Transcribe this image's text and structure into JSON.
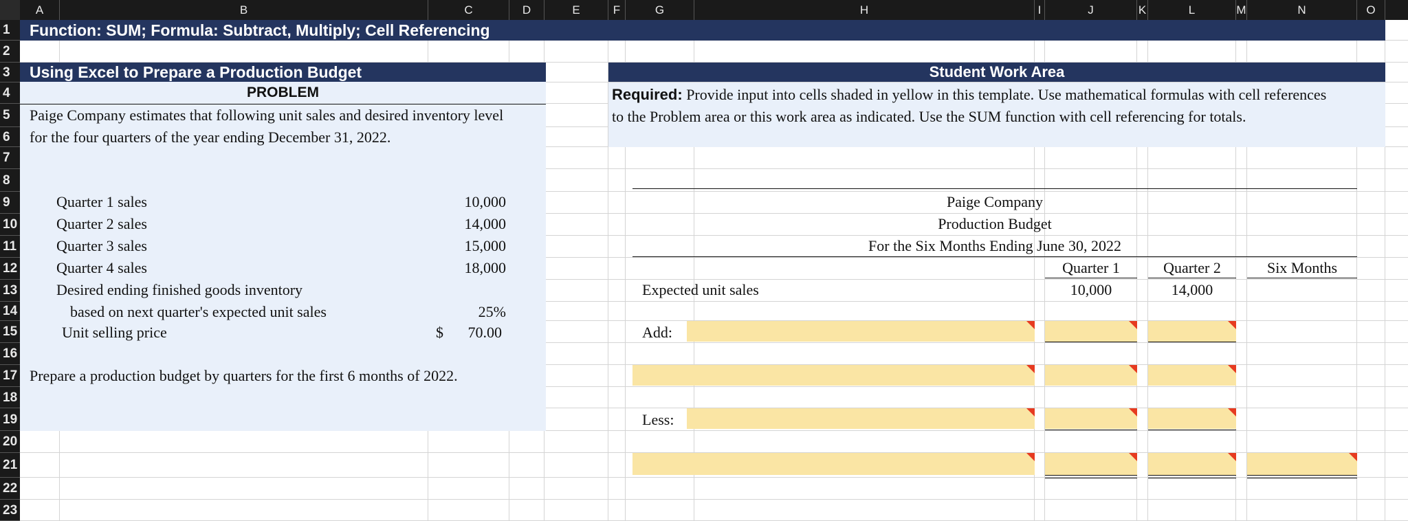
{
  "columns": [
    "A",
    "B",
    "C",
    "D",
    "E",
    "F",
    "G",
    "H",
    "I",
    "J",
    "K",
    "L",
    "M",
    "N",
    "O"
  ],
  "rows": [
    "1",
    "2",
    "3",
    "4",
    "5",
    "6",
    "7",
    "8",
    "9",
    "10",
    "11",
    "12",
    "13",
    "14",
    "15",
    "16",
    "17",
    "18",
    "19",
    "20",
    "21",
    "22",
    "23"
  ],
  "title": "Function: SUM; Formula: Subtract, Multiply; Cell Referencing",
  "problem": {
    "header": "Using Excel to Prepare a Production Budget",
    "subheader": "PROBLEM",
    "intro_line1": "Paige Company estimates that following unit sales and desired inventory level",
    "intro_line2": "for the four quarters of the year ending December 31, 2022.",
    "items": [
      {
        "label": "Quarter 1 sales",
        "value": "10,000"
      },
      {
        "label": "Quarter 2 sales",
        "value": "14,000"
      },
      {
        "label": "Quarter 3 sales",
        "value": "15,000"
      },
      {
        "label": "Quarter 4 sales",
        "value": "18,000"
      }
    ],
    "inventory_label1": "Desired ending finished goods inventory",
    "inventory_label2": "based on next quarter's expected unit sales",
    "inventory_value": "25%",
    "price_label": "Unit selling price",
    "price_currency": "$",
    "price_value": "70.00",
    "instruction": "Prepare a production budget by quarters for the first 6 months of 2022."
  },
  "work_area": {
    "header": "Student Work Area",
    "required_bold": "Required:",
    "required_text1": " Provide input into cells shaded in yellow in this template. Use mathematical formulas with cell references",
    "required_text2": "to the Problem area or this work area as indicated. Use the SUM function with cell referencing for totals.",
    "company": "Paige Company",
    "statement": "Production Budget",
    "period": "For the Six Months Ending June 30, 2022",
    "col_q1": "Quarter 1",
    "col_q2": "Quarter 2",
    "col_six": "Six Months",
    "expected_label": "Expected unit sales",
    "expected_q1": "10,000",
    "expected_q2": "14,000",
    "add_label": "Add:",
    "less_label": "Less:"
  },
  "colors": {
    "navy": "#24355f",
    "light_blue": "#e9f0fa",
    "yellow": "#fae5a4",
    "comment_marker": "#e63b20"
  }
}
